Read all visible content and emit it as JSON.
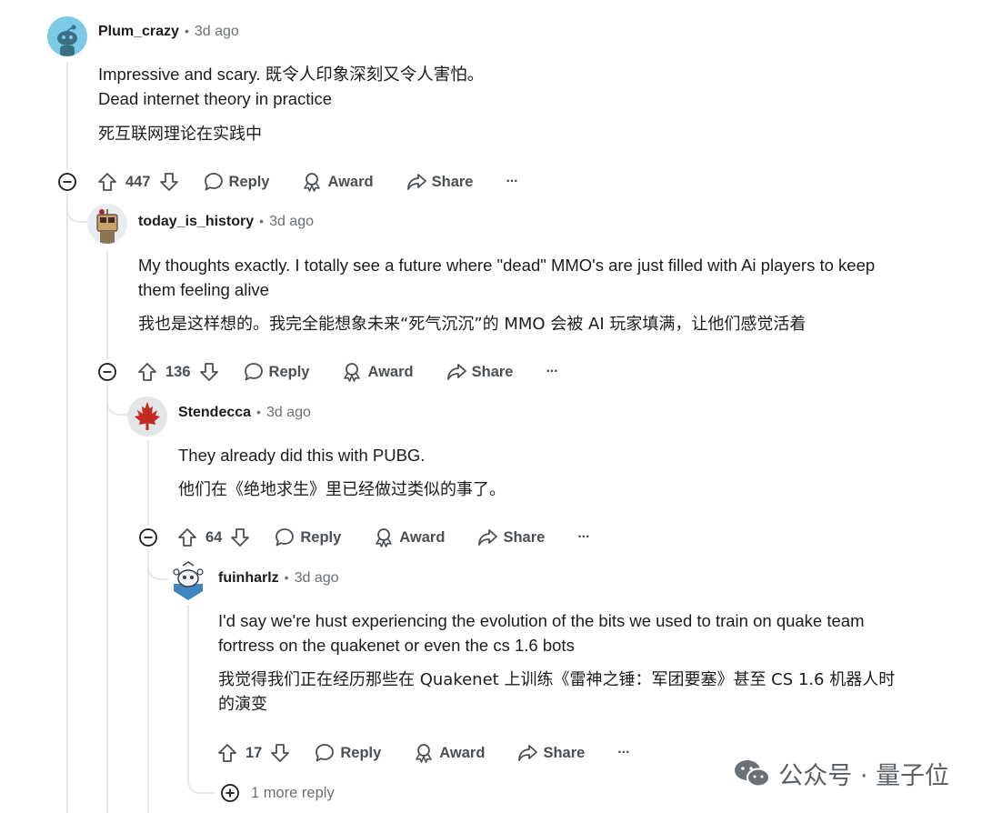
{
  "comments": [
    {
      "author": "Plum_crazy",
      "age": "3d ago",
      "text": [
        "Impressive and scary.  既令人印象深刻又令人害怕。",
        "Dead internet theory in practice"
      ],
      "translation": "死互联网理论在实践中",
      "votes": "447"
    },
    {
      "author": "today_is_history",
      "age": "3d ago",
      "text": [
        "My thoughts exactly. I totally see a future where \"dead\" MMO's are just filled with Ai players to keep",
        "them feeling alive"
      ],
      "translation": "我也是这样想的。我完全能想象未来“死气沉沉”的 MMO 会被 AI 玩家填满，让他们感觉活着",
      "votes": "136"
    },
    {
      "author": "Stendecca",
      "age": "3d ago",
      "text": [
        "They already did this with PUBG."
      ],
      "translation": "他们在《绝地求生》里已经做过类似的事了。",
      "votes": "64"
    },
    {
      "author": "fuinharlz",
      "age": "3d ago",
      "text": [
        "I'd say we're hust experiencing the evolution of the bits we used to train on quake team",
        "fortress on the quakenet or even the cs 1.6 bots"
      ],
      "translation": [
        "我觉得我们正在经历那些在 Quakenet 上训练《雷神之锤：军团要塞》甚至 CS 1.6 机器人时",
        "的演变"
      ],
      "votes": "17"
    }
  ],
  "actions": {
    "reply": "Reply",
    "award": "Award",
    "share": "Share",
    "more": "···"
  },
  "more_replies": "1 more reply",
  "watermark": {
    "text": "公众号 · 量子位",
    "icon": "wechat-icon"
  }
}
